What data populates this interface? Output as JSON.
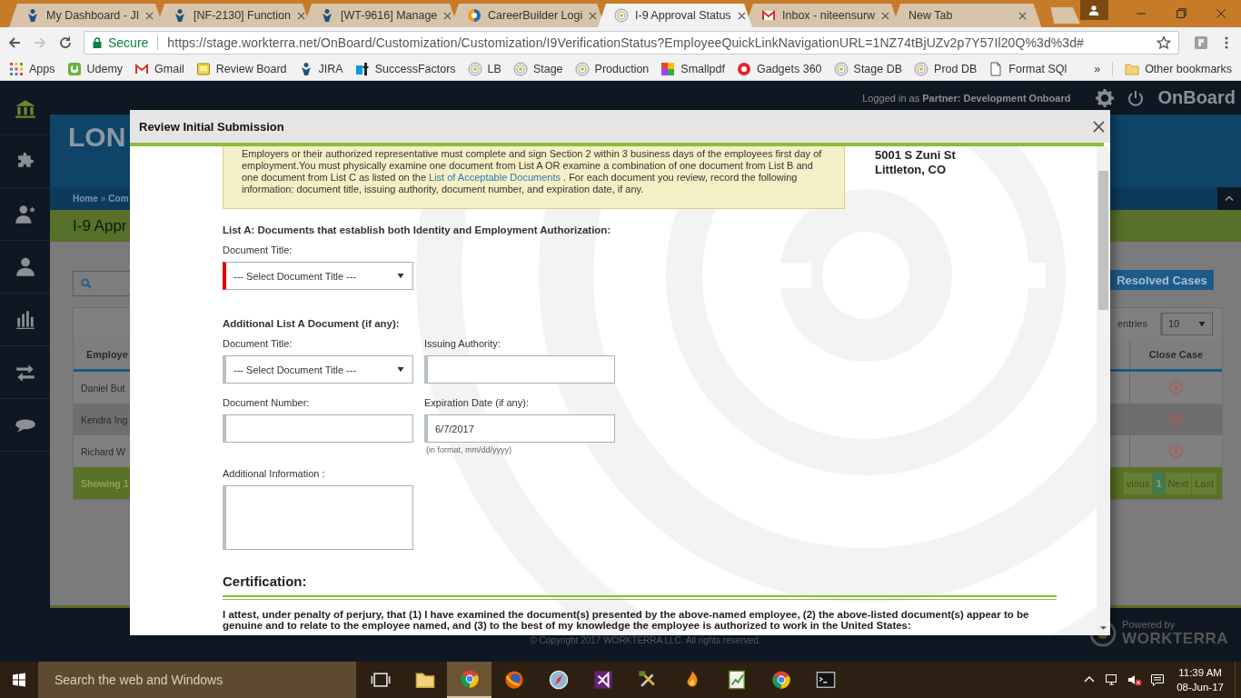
{
  "browser": {
    "tabs": [
      {
        "title": "My Dashboard - JI",
        "kind": "jira",
        "selected": false
      },
      {
        "title": "[NF-2130] Function",
        "kind": "jira",
        "selected": false
      },
      {
        "title": "[WT-9616] Manage",
        "kind": "jira",
        "selected": false
      },
      {
        "title": "CareerBuilder Logi",
        "kind": "careerbuilder",
        "selected": false
      },
      {
        "title": "I-9 Approval Status",
        "kind": "workterra",
        "selected": true
      },
      {
        "title": "Inbox - niteensurw",
        "kind": "gmail",
        "selected": false
      },
      {
        "title": "New Tab",
        "kind": "blank",
        "selected": false
      }
    ],
    "secure_label": "Secure",
    "url": "https://stage.workterra.net/OnBoard/Customization/Customization/I9VerificationStatus?EmployeeQuickLinkNavigationURL=1NZ74tBjUZv2p7Y57Il20Q%3d%3d#",
    "bookmarks": [
      {
        "label": "Apps",
        "kind": "apps"
      },
      {
        "label": "Udemy",
        "kind": "udemy"
      },
      {
        "label": "Gmail",
        "kind": "gmail"
      },
      {
        "label": "Review Board",
        "kind": "note"
      },
      {
        "label": "JIRA",
        "kind": "jira"
      },
      {
        "label": "SuccessFactors",
        "kind": "sf"
      },
      {
        "label": "LB",
        "kind": "workterra"
      },
      {
        "label": "Stage",
        "kind": "workterra"
      },
      {
        "label": "Production",
        "kind": "workterra"
      },
      {
        "label": "Smallpdf",
        "kind": "smallpdf"
      },
      {
        "label": "Gadgets 360",
        "kind": "gadgets"
      },
      {
        "label": "Stage DB",
        "kind": "workterra"
      },
      {
        "label": "Prod DB",
        "kind": "workterra"
      },
      {
        "label": "Format SQl",
        "kind": "page"
      }
    ],
    "overflow": "»",
    "other_bookmarks": "Other bookmarks"
  },
  "app": {
    "sidebar": [
      {
        "kind": "home",
        "selected": true
      },
      {
        "kind": "puzzle",
        "selected": false
      },
      {
        "kind": "person-star",
        "selected": false
      },
      {
        "kind": "person",
        "selected": false
      },
      {
        "kind": "chart",
        "selected": false
      },
      {
        "kind": "arrows",
        "selected": false
      },
      {
        "kind": "chat",
        "selected": false
      }
    ],
    "logged_in": "Logged in as **Partner:  Development Onboard**",
    "brand": "OnBoard",
    "logo": "LON",
    "breadcrumb": [
      "Home",
      "Com"
    ],
    "breadcrumb_separator": "»",
    "page_title": "I-9 Appr",
    "resolved_button": "Resolved Cases",
    "entries_label": "entries",
    "page_size": "10",
    "columns": [
      "Employe",
      "Close Case"
    ],
    "rows": [
      {
        "name": "Daniel But"
      },
      {
        "name": "Kendra Ing"
      },
      {
        "name": "Richard W"
      }
    ],
    "showing": "Showing 1",
    "pagination": [
      {
        "label": "vious",
        "selected": false
      },
      {
        "label": "1",
        "selected": true
      },
      {
        "label": "Next",
        "selected": false
      },
      {
        "label": "Last",
        "selected": false
      }
    ],
    "copyright": "© Copyright 2017 WORKTERRA LLC. All rights reserved.",
    "powered_by": "Powered by",
    "powered_brand": "WORKTERRA"
  },
  "modal": {
    "title": "Review Initial Submission",
    "instructions_before": "Employers or their authorized representative must complete and sign Section 2 within 3 business days of the employees first day of employment.You must physically examine one document from List A OR examine a combination of one document from List B and one document from List C as listed on the",
    "instructions_link": "List of Acceptable Documents",
    "instructions_after": ". For each document you review, record the following information: document title, issuing authority, document number, and expiration date, if any.",
    "address": [
      "5001 S Zuni St",
      "Littleton, CO"
    ],
    "list_a_heading": "List A: Documents that establish both Identity and Employment Authorization:",
    "list_a_fields": [
      {
        "kind": "select",
        "label": "Document Title:",
        "value": "--- Select Document Title ---",
        "invalid": true
      }
    ],
    "additional_heading": "Additional List A Document (if any):",
    "additional_fields": [
      {
        "kind": "select",
        "label": "Document Title:",
        "value": "--- Select Document Title ---",
        "invalid": false
      },
      {
        "kind": "input",
        "label": "Issuing Authority:",
        "invalid": false
      },
      {
        "kind": "input",
        "label": "Document Number:",
        "invalid": false
      },
      {
        "kind": "input",
        "label": "Expiration Date (if any):",
        "value": "6/7/2017",
        "hint": "(in format, mm/dd/yyyy)",
        "invalid": false
      },
      {
        "kind": "textarea",
        "label": "Additional Information :",
        "invalid": false
      }
    ],
    "certification_heading": "Certification:",
    "certification_text": "I attest, under penalty of perjury, that (1) I have examined the document(s) presented by the above-named employee, (2) the above-listed document(s) appear to be genuine and to relate to the employee named, and (3) to the best of my knowledge the employee is authorized to work in the United States:"
  },
  "taskbar": {
    "search_placeholder": "Search the web and Windows",
    "apps": [
      {
        "kind": "taskview",
        "selected": false
      },
      {
        "kind": "folder",
        "selected": false
      },
      {
        "kind": "chrome",
        "selected": true
      },
      {
        "kind": "firefox",
        "selected": false
      },
      {
        "kind": "compass",
        "selected": false
      },
      {
        "kind": "vs",
        "selected": false
      },
      {
        "kind": "tools",
        "selected": false
      },
      {
        "kind": "flame",
        "selected": false
      },
      {
        "kind": "chart",
        "selected": false
      },
      {
        "kind": "chrome",
        "selected": false
      },
      {
        "kind": "terminal",
        "selected": false
      }
    ],
    "time": "11:39 AM",
    "date": "08-Jun-17"
  }
}
